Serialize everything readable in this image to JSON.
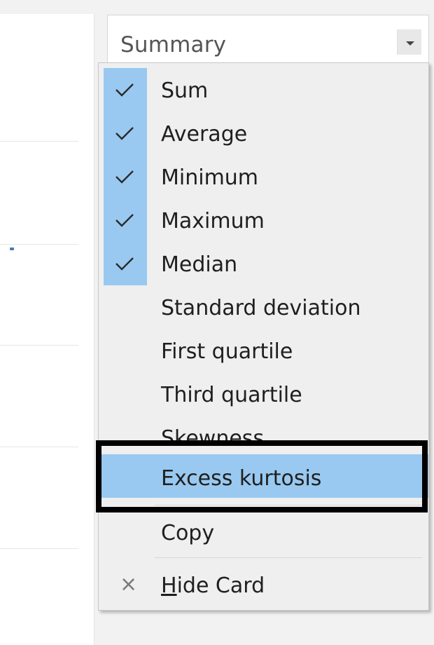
{
  "summary": {
    "title": "Summary",
    "dropdown_icon": "chevron-down-icon"
  },
  "menu": {
    "items": [
      {
        "label": "Sum",
        "checked": true
      },
      {
        "label": "Average",
        "checked": true
      },
      {
        "label": "Minimum",
        "checked": true
      },
      {
        "label": "Maximum",
        "checked": true
      },
      {
        "label": "Median",
        "checked": true
      },
      {
        "label": "Standard deviation",
        "checked": false
      },
      {
        "label": "First quartile",
        "checked": false
      },
      {
        "label": "Third quartile",
        "checked": false
      },
      {
        "label": "Skewness",
        "checked": false
      },
      {
        "label": "Excess kurtosis",
        "checked": false,
        "highlighted": true
      }
    ],
    "copy_label": "Copy",
    "hide_card_label": "Hide Card",
    "hide_card_icon": "close-icon",
    "check_icon": "checkmark-icon"
  },
  "colors": {
    "selection": "#99c9f0",
    "menu_background": "#efefef",
    "focus_outline": "#000000"
  }
}
